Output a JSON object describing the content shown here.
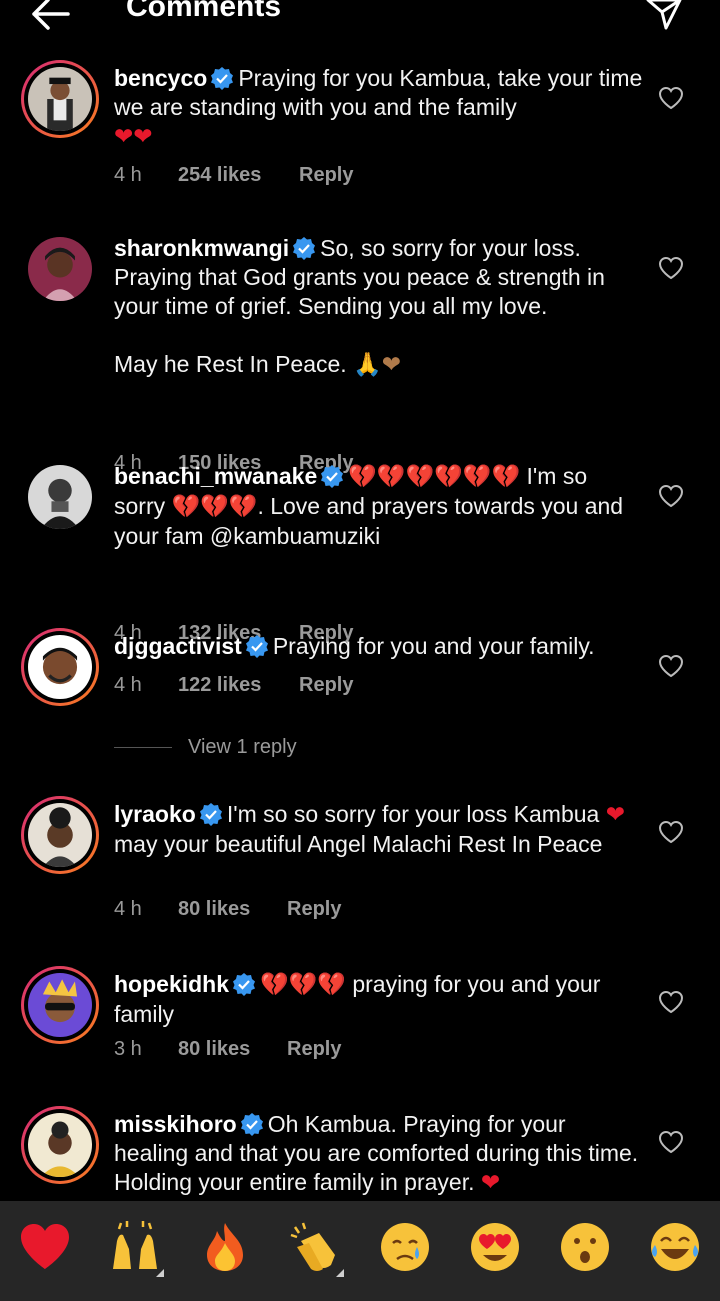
{
  "header": {
    "title": "Comments",
    "back_icon": "arrow-left-icon",
    "send_icon": "paper-plane-icon"
  },
  "comments": [
    {
      "username": "bencyco",
      "verified": true,
      "text": "Praying for you Kambua, take your time we are standing with you and the family",
      "emoji": "❤❤",
      "time": "4 h",
      "likes": "254 likes",
      "reply": "Reply",
      "story_ring": true
    },
    {
      "username": "sharonkmwangi",
      "verified": true,
      "text": "So, so sorry for your loss. Praying that God grants you peace & strength in your time of grief. Sending you all my love.",
      "text2": "May he Rest In Peace.",
      "emoji": "🙏❤",
      "time": "4 h",
      "likes": "150 likes",
      "reply": "Reply",
      "story_ring": false
    },
    {
      "username": "benachi_mwanake",
      "verified": true,
      "emoji_lead": "💔💔💔💔💔💔",
      "text_a": "I'm so sorry",
      "emoji_mid": "💔💔💔",
      "text_b": ". Love and prayers towards you and your fam @kambuamuziki",
      "time": "4 h",
      "likes": "132 likes",
      "reply": "Reply",
      "story_ring": false
    },
    {
      "username": "djggactivist",
      "verified": true,
      "text": "Praying for you and your family.",
      "time": "4 h",
      "likes": "122 likes",
      "reply": "Reply",
      "story_ring": true,
      "view_replies": "View 1 reply"
    },
    {
      "username": "lyraoko",
      "verified": true,
      "text_a": "I'm so so sorry for your loss Kambua",
      "emoji": "❤",
      "text_b": "may your beautiful Angel Malachi Rest In Peace",
      "time": "4 h",
      "likes": "80 likes",
      "reply": "Reply",
      "story_ring": true
    },
    {
      "username": "hopekidhk",
      "verified": true,
      "emoji": "💔💔💔",
      "text": "praying for you and your family",
      "time": "3 h",
      "likes": "80 likes",
      "reply": "Reply",
      "story_ring": true
    },
    {
      "username": "misskihoro",
      "verified": true,
      "text": "Oh Kambua. Praying for your healing and that you are comforted during this time. Holding your entire family in prayer.",
      "emoji": "❤",
      "story_ring": true
    }
  ],
  "reactions": [
    {
      "name": "red-heart",
      "color": "#e8192c"
    },
    {
      "name": "raising-hands",
      "color": "#f7c23a"
    },
    {
      "name": "fire",
      "color": "#f25c1f"
    },
    {
      "name": "clapping-hands",
      "color": "#f7c23a"
    },
    {
      "name": "crying-face",
      "color": "#f7c23a"
    },
    {
      "name": "heart-eyes-face",
      "color": "#f7c23a"
    },
    {
      "name": "surprised-face",
      "color": "#f7c23a"
    },
    {
      "name": "tears-of-joy-face",
      "color": "#f7c23a"
    }
  ],
  "colors": {
    "background": "#000000",
    "secondary_text": "#9a9a9a",
    "verified_blue": "#3897f0",
    "reaction_bar": "#262626"
  }
}
